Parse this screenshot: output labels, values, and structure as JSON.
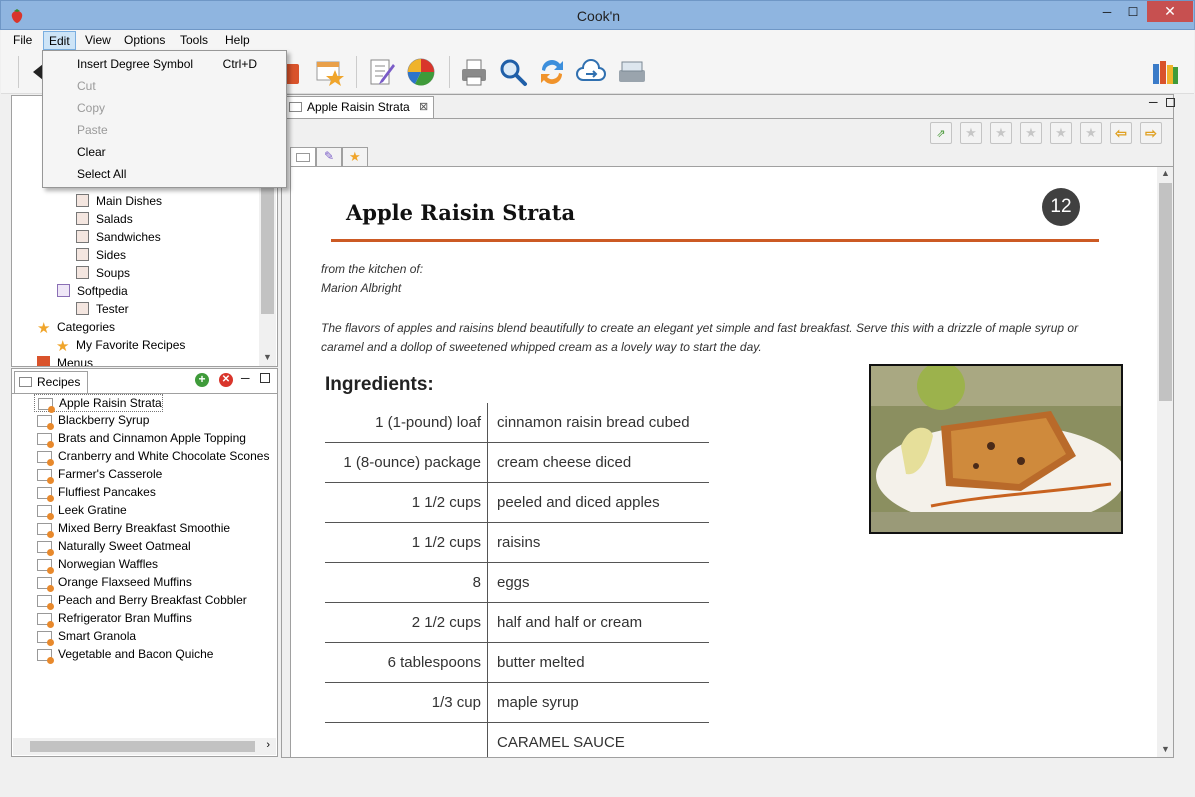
{
  "window": {
    "title": "Cook'n",
    "minimize": "─",
    "maximize": "☐",
    "close": "✕"
  },
  "menu": {
    "items": [
      "File",
      "Edit",
      "View",
      "Options",
      "Tools",
      "Help"
    ]
  },
  "edit_menu": {
    "items": [
      {
        "label": "Insert Degree Symbol",
        "shortcut": "Ctrl+D",
        "enabled": true
      },
      {
        "label": "Cut",
        "enabled": false
      },
      {
        "label": "Copy",
        "enabled": false
      },
      {
        "label": "Paste",
        "enabled": false
      },
      {
        "label": "Clear",
        "enabled": true
      },
      {
        "label": "Select All",
        "enabled": true
      }
    ]
  },
  "tree": {
    "items": [
      {
        "label": "Main Dishes",
        "icon": "book-icon"
      },
      {
        "label": "Salads",
        "icon": "book-icon"
      },
      {
        "label": "Sandwiches",
        "icon": "book-icon"
      },
      {
        "label": "Sides",
        "icon": "book-icon"
      },
      {
        "label": "Soups",
        "icon": "book-icon"
      },
      {
        "label": "Softpedia",
        "icon": "user-book-icon"
      },
      {
        "label": "Tester",
        "icon": "book-icon"
      },
      {
        "label": "Categories",
        "icon": "star-icon"
      },
      {
        "label": "My Favorite Recipes",
        "icon": "star-icon"
      },
      {
        "label": "Menus",
        "icon": "menus-icon"
      }
    ]
  },
  "recipes_panel": {
    "tab": "Recipes",
    "items": [
      "Apple Raisin Strata",
      "Blackberry Syrup",
      "Brats and Cinnamon Apple Topping",
      "Cranberry and White Chocolate Scones",
      "Farmer's Casserole",
      "Fluffiest Pancakes",
      "Leek Gratine",
      "Mixed Berry Breakfast Smoothie",
      "Naturally Sweet Oatmeal",
      "Norwegian Waffles",
      "Orange Flaxseed Muffins",
      "Peach and Berry Breakfast Cobbler",
      "Refrigerator Bran Muffins",
      "Smart Granola",
      "Vegetable and Bacon Quiche"
    ],
    "selected": "Apple Raisin Strata"
  },
  "document": {
    "tab_label": "Apple Raisin Strata",
    "title": "Apple Raisin Strata",
    "servings": "12",
    "from_label": "from the kitchen of:",
    "author": "Marion Albright",
    "description": "The flavors of apples and raisins blend beautifully to create an elegant yet simple and fast breakfast. Serve this with a drizzle of maple syrup or caramel and a dollop of sweetened whipped cream as a lovely way to start the day.",
    "ingredients_heading": "Ingredients:",
    "ingredients": [
      {
        "qty": "1 (1-pound) loaf",
        "name": "cinnamon raisin bread cubed"
      },
      {
        "qty": "1 (8-ounce) package",
        "name": "cream cheese diced"
      },
      {
        "qty": "1 1/2 cups",
        "name": "peeled and diced apples"
      },
      {
        "qty": "1 1/2 cups",
        "name": "raisins"
      },
      {
        "qty": "8",
        "name": "eggs"
      },
      {
        "qty": "2 1/2 cups",
        "name": "half and half or cream"
      },
      {
        "qty": "6 tablespoons",
        "name": "butter melted"
      },
      {
        "qty": "1/3 cup",
        "name": "maple syrup"
      },
      {
        "qty": "",
        "name": "CARAMEL SAUCE"
      }
    ]
  },
  "colors": {
    "accent_rule": "#cc5a24",
    "titlebar": "#8fb5e0",
    "close_button": "#c75050"
  }
}
